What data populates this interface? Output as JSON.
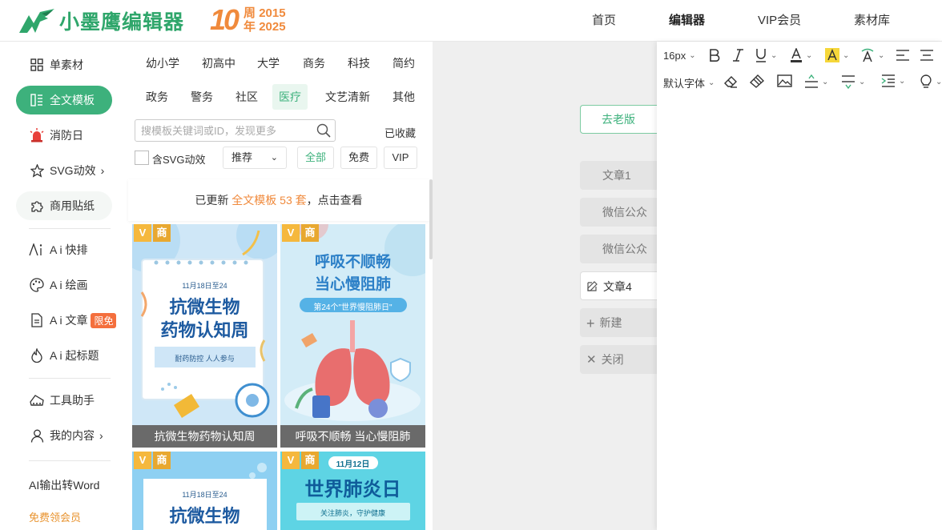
{
  "header": {
    "brand": "小墨鹰编辑器",
    "anniv_number": "10",
    "anniv_line1": "周 2015",
    "anniv_line2": "年 2025",
    "nav": [
      "首页",
      "编辑器",
      "VIP会员",
      "素材库"
    ]
  },
  "sidebar": {
    "items": [
      "单素材",
      "全文模板",
      "消防日",
      "SVG动效",
      "商用贴纸",
      "A i 快排",
      "A i 绘画",
      "A i 文章",
      "A i 起标题",
      "工具助手",
      "我的内容"
    ],
    "badge": "限免",
    "ai_word": "AI输出转Word",
    "free_vip": "免费领会员"
  },
  "templates": {
    "categories_row1": [
      "幼小学",
      "初高中",
      "大学",
      "商务",
      "科技",
      "简约"
    ],
    "categories_row2": [
      "政务",
      "警务",
      "社区",
      "医疗",
      "文艺清新",
      "其他"
    ],
    "search_placeholder": "搜模板关键词或ID，发现更多",
    "collected": "已收藏",
    "svg_label": "含SVG动效",
    "sort": "推荐",
    "filters": [
      "全部",
      "免费",
      "VIP"
    ],
    "notice_pre": "已更新 ",
    "notice_hl": "全文模板 53 套",
    "notice_post": "，点击查看",
    "tag_v": "V",
    "tag_s": "商",
    "cards": [
      {
        "caption": "抗微生物药物认知周",
        "date": "11月18日至24",
        "title1": "抗微生物",
        "title2": "药物认知周",
        "sub": "耐药防控  人人参与"
      },
      {
        "caption": "呼吸不顺畅 当心慢阻肺",
        "title1": "呼吸不顺畅",
        "title2": "当心慢阻肺",
        "sub": "第24个\"世界慢阻肺日\""
      },
      {
        "date": "11月18日至24",
        "title1": "抗微生物"
      },
      {
        "date": "11月12日",
        "title1": "世界肺炎日",
        "sub": "关注肺炎，守护健康"
      }
    ]
  },
  "docs": {
    "old": "去老版",
    "items": [
      "文章1",
      "微信公众",
      "微信公众",
      "文章4"
    ],
    "new": "新建",
    "close": "关闭"
  },
  "editor": {
    "font_size": "16px",
    "font_family": "默认字体"
  },
  "colors": {
    "brand_green": "#3db17c",
    "accent_orange": "#f08a3c"
  }
}
